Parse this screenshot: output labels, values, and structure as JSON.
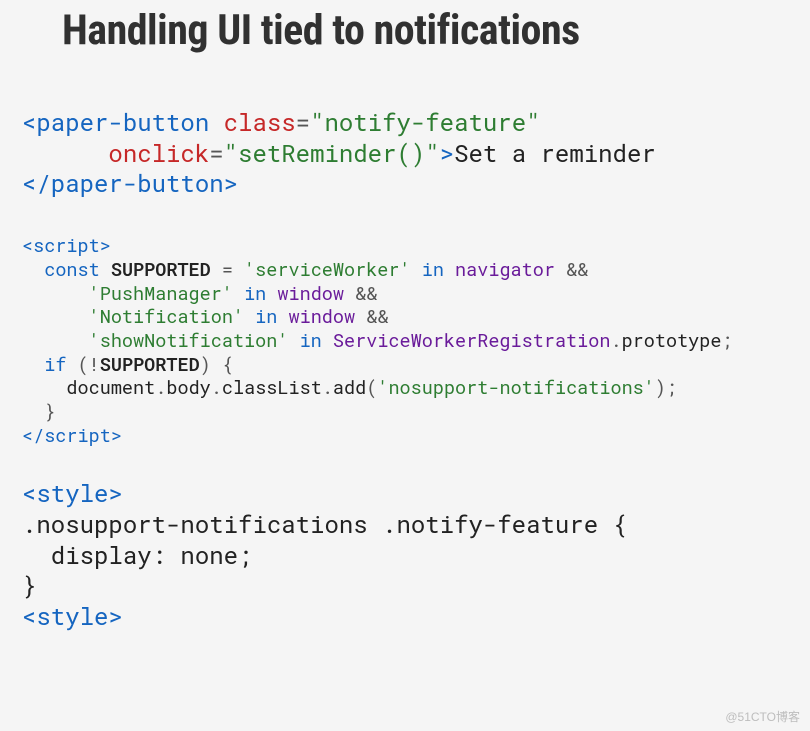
{
  "title": "Handling UI tied to notifications",
  "watermark": "@51CTO博客",
  "code_a": {
    "l1": {
      "open": "<paper-button",
      "sp1": " ",
      "attr1": "class",
      "eq1": "=",
      "val1": "\"notify-feature\""
    },
    "l2": {
      "indent": "      ",
      "attr2": "onclick",
      "eq2": "=",
      "val2": "\"setReminder()\"",
      "gt": ">",
      "text": "Set a reminder"
    },
    "l3": {
      "close": "</paper-button>"
    }
  },
  "code_b": {
    "l1": {
      "open": "<script>"
    },
    "l2": {
      "indent": "  ",
      "kw": "const",
      "sp": " ",
      "id": "SUPPORTED",
      "eq": " = ",
      "str": "'serviceWorker'",
      "sp2": " ",
      "kw2": "in",
      "sp3": " ",
      "obj": "navigator",
      "amp": " &&"
    },
    "l3": {
      "indent": "      ",
      "str": "'PushManager'",
      "sp": " ",
      "kw": "in",
      "sp2": " ",
      "obj": "window",
      "amp": " &&"
    },
    "l4": {
      "indent": "      ",
      "str": "'Notification'",
      "sp": " ",
      "kw": "in",
      "sp2": " ",
      "obj": "window",
      "amp": " &&"
    },
    "l5": {
      "indent": "      ",
      "str": "'showNotification'",
      "sp": " ",
      "kw": "in",
      "sp2": " ",
      "obj": "ServiceWorkerRegistration",
      "dot": ".",
      "prop": "prototype",
      "semi": ";"
    },
    "l6": {
      "indent": "  ",
      "kw": "if",
      "sp": " ",
      "p1": "(!",
      "id": "SUPPORTED",
      "p2": ") {"
    },
    "l7": {
      "indent": "    ",
      "obj1": "document",
      "d1": ".",
      "obj2": "body",
      "d2": ".",
      "obj3": "classList",
      "d3": ".",
      "fn": "add",
      "p1": "(",
      "str": "'nosupport-notifications'",
      "p2": ");"
    },
    "l8": {
      "indent": "  ",
      "brace": "}"
    },
    "l9": {
      "close": "</script>"
    }
  },
  "code_c": {
    "l1": {
      "open": "<style>"
    },
    "l2": {
      "sel": ".nosupport-notifications .notify-feature {"
    },
    "l3": {
      "rule": "  display: none;"
    },
    "l4": {
      "brace": "}"
    },
    "l5": {
      "open": "<style>"
    }
  }
}
